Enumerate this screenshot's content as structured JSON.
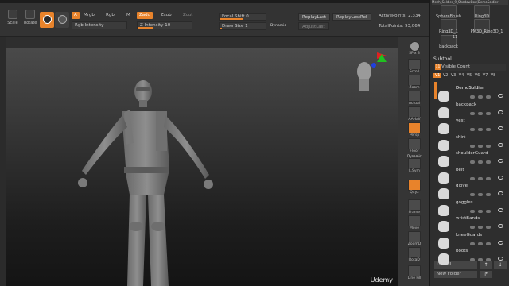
{
  "toolbar": {
    "scale_label": "Scale",
    "rotate_label": "Rotate",
    "a_label": "A",
    "mrgb_label": "Mrgb",
    "rgb_label": "Rgb",
    "m_label": "M",
    "zadd_label": "Zadd",
    "zsub_label": "Zsub",
    "zcut_label": "Zcut",
    "rgb_intensity_label": "Rgb Intensity",
    "z_intensity_label": "Z Intensity 10",
    "z_intensity": 10,
    "focal_shift_label": "Focal Shift 0",
    "focal_shift": 0,
    "draw_size_label": "Draw Size 1",
    "draw_size": 1,
    "dynamic_label": "Dynamic",
    "replay_last_label": "ReplayLast",
    "replay_last_rel_label": "ReplayLastRel",
    "adjust_last_label": "AdjustLast",
    "active_points_label": "ActivePoints: 2,334",
    "total_points_label": "TotalPoints: 93,064"
  },
  "shelf": {
    "spix_label": "SPix 3",
    "items": [
      "Scroll",
      "Zoom",
      "Actual",
      "AAHalf",
      "Persp",
      "Floor",
      "L.Sym",
      "Qxyz",
      "Frame",
      "Move",
      "ZoomD",
      "RotaD",
      "Line Fill"
    ],
    "dynamic_label": "Dynamic"
  },
  "panel": {
    "tool_header": "Mech_Soldier_9_ShadowBox(DemoSoldier)",
    "brushes": [
      {
        "label": "SphereBrush"
      },
      {
        "label": "Ring3D"
      },
      {
        "label": "Ring3D_1"
      },
      {
        "label": "PM3D_Ring3D_1"
      },
      {
        "label": "backpack"
      }
    ],
    "ring_count": "11",
    "subtool_title": "Subtool",
    "visible_count_label": "Visible Count",
    "visible_count": "11",
    "v_tabs": [
      "V1",
      "V2",
      "V3",
      "V4",
      "V5",
      "V6",
      "V7",
      "V8"
    ],
    "subtools": [
      {
        "name": "DemoSoldier"
      },
      {
        "name": "backpack"
      },
      {
        "name": "vest"
      },
      {
        "name": "shirt"
      },
      {
        "name": "shoulderGuard"
      },
      {
        "name": "belt"
      },
      {
        "name": "glove"
      },
      {
        "name": "goggles"
      },
      {
        "name": "wristBands"
      },
      {
        "name": "kneeGuards"
      },
      {
        "name": "boots"
      }
    ],
    "list_all_label": "List All",
    "new_folder_label": "New Folder",
    "up_arrow": "↑",
    "down_arrow": "↓",
    "next_arrow": "↱"
  },
  "watermark": "Udemy",
  "colors": {
    "accent": "#e8832b",
    "panel_bg": "#2e2e2e",
    "axis_x": "#e02020",
    "axis_y": "#20c020",
    "axis_z": "#2040e0"
  }
}
